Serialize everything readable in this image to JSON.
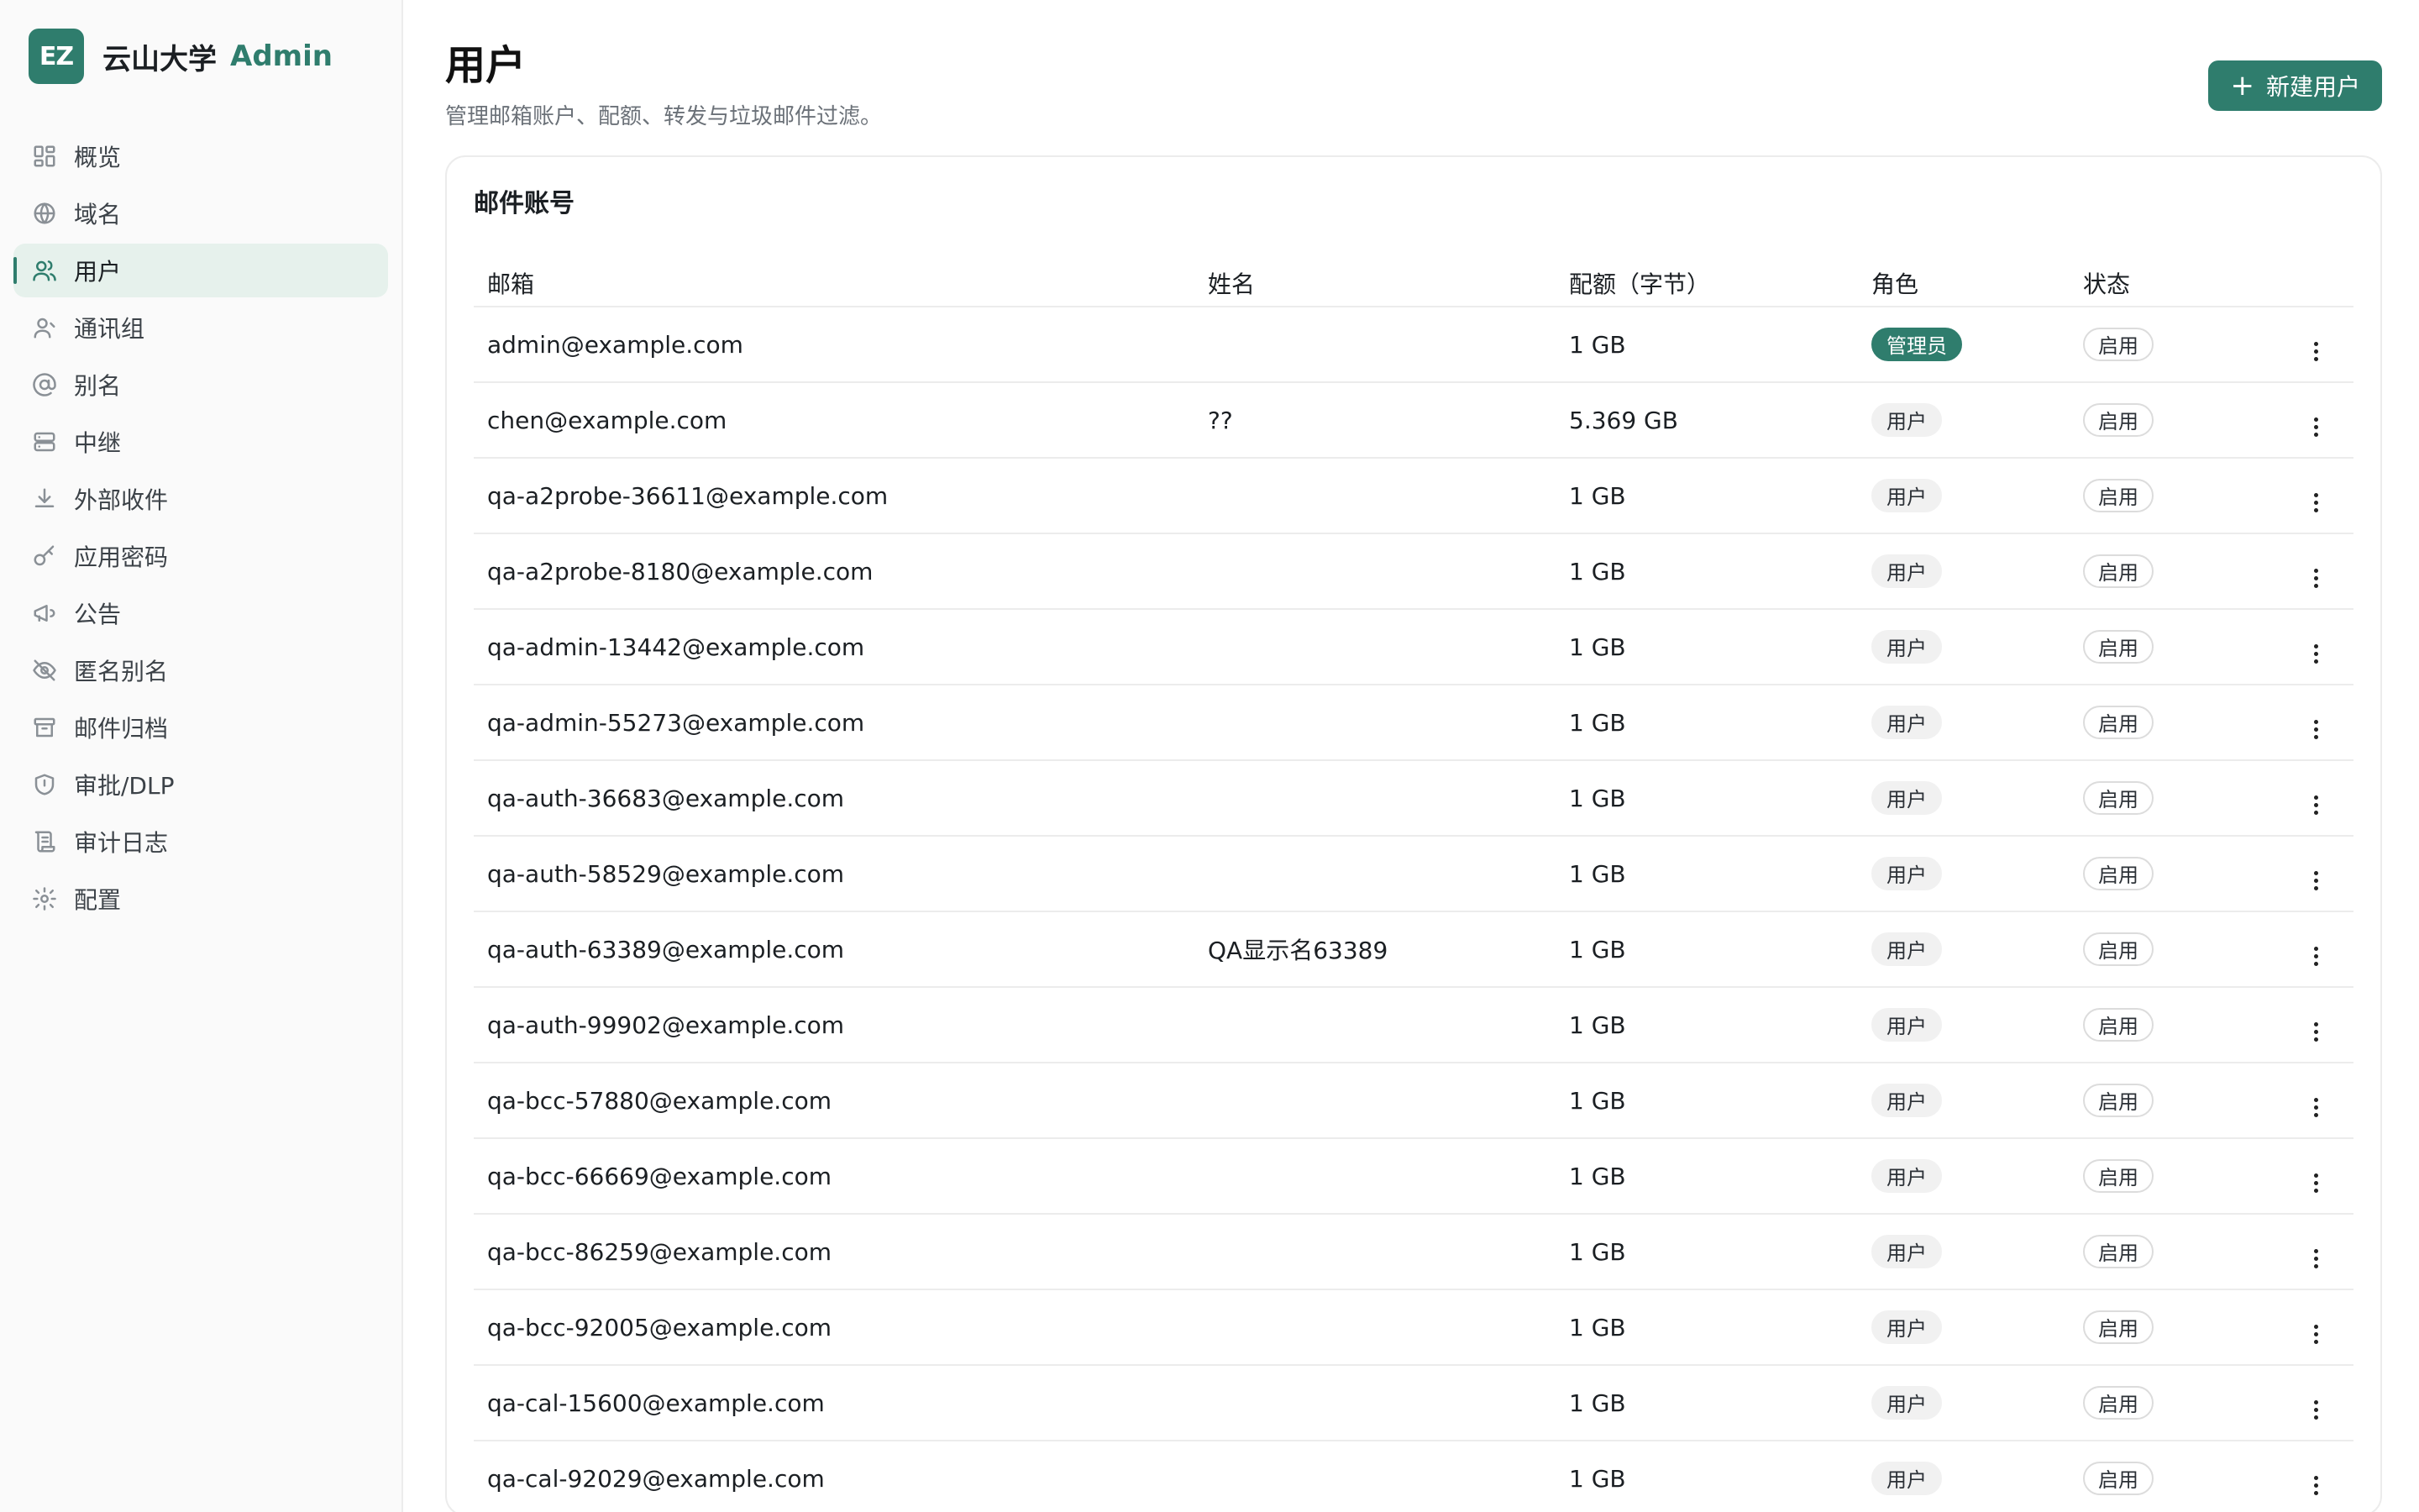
{
  "brand": {
    "logo": "EZ",
    "name": "云山大学",
    "admin": "Admin",
    "color": "#2f7d6d"
  },
  "sidebar": {
    "items": [
      {
        "label": "概览",
        "icon": "dashboard-icon"
      },
      {
        "label": "域名",
        "icon": "globe-icon"
      },
      {
        "label": "用户",
        "icon": "users-icon",
        "active": true
      },
      {
        "label": "通讯组",
        "icon": "user-group-icon"
      },
      {
        "label": "别名",
        "icon": "at-icon"
      },
      {
        "label": "中继",
        "icon": "server-icon"
      },
      {
        "label": "外部收件",
        "icon": "download-icon"
      },
      {
        "label": "应用密码",
        "icon": "key-icon"
      },
      {
        "label": "公告",
        "icon": "megaphone-icon"
      },
      {
        "label": "匿名别名",
        "icon": "eye-off-icon"
      },
      {
        "label": "邮件归档",
        "icon": "archive-icon"
      },
      {
        "label": "审批/DLP",
        "icon": "shield-icon"
      },
      {
        "label": "审计日志",
        "icon": "scroll-icon"
      },
      {
        "label": "配置",
        "icon": "gear-icon"
      }
    ]
  },
  "header": {
    "title": "用户",
    "subtitle": "管理邮箱账户、配额、转发与垃圾邮件过滤。",
    "new_button": "新建用户"
  },
  "card": {
    "title": "邮件账号",
    "columns": [
      "邮箱",
      "姓名",
      "配额（字节）",
      "角色",
      "状态"
    ],
    "rows": [
      {
        "email": "admin@example.com",
        "name": "",
        "quota": "1 GB",
        "role": "管理员",
        "role_admin": true,
        "status": "启用"
      },
      {
        "email": "chen@example.com",
        "name": "??",
        "quota": "5.369 GB",
        "role": "用户",
        "status": "启用"
      },
      {
        "email": "qa-a2probe-36611@example.com",
        "name": "",
        "quota": "1 GB",
        "role": "用户",
        "status": "启用"
      },
      {
        "email": "qa-a2probe-8180@example.com",
        "name": "",
        "quota": "1 GB",
        "role": "用户",
        "status": "启用"
      },
      {
        "email": "qa-admin-13442@example.com",
        "name": "",
        "quota": "1 GB",
        "role": "用户",
        "status": "启用"
      },
      {
        "email": "qa-admin-55273@example.com",
        "name": "",
        "quota": "1 GB",
        "role": "用户",
        "status": "启用"
      },
      {
        "email": "qa-auth-36683@example.com",
        "name": "",
        "quota": "1 GB",
        "role": "用户",
        "status": "启用"
      },
      {
        "email": "qa-auth-58529@example.com",
        "name": "",
        "quota": "1 GB",
        "role": "用户",
        "status": "启用"
      },
      {
        "email": "qa-auth-63389@example.com",
        "name": "QA显示名63389",
        "quota": "1 GB",
        "role": "用户",
        "status": "启用"
      },
      {
        "email": "qa-auth-99902@example.com",
        "name": "",
        "quota": "1 GB",
        "role": "用户",
        "status": "启用"
      },
      {
        "email": "qa-bcc-57880@example.com",
        "name": "",
        "quota": "1 GB",
        "role": "用户",
        "status": "启用"
      },
      {
        "email": "qa-bcc-66669@example.com",
        "name": "",
        "quota": "1 GB",
        "role": "用户",
        "status": "启用"
      },
      {
        "email": "qa-bcc-86259@example.com",
        "name": "",
        "quota": "1 GB",
        "role": "用户",
        "status": "启用"
      },
      {
        "email": "qa-bcc-92005@example.com",
        "name": "",
        "quota": "1 GB",
        "role": "用户",
        "status": "启用"
      },
      {
        "email": "qa-cal-15600@example.com",
        "name": "",
        "quota": "1 GB",
        "role": "用户",
        "status": "启用"
      },
      {
        "email": "qa-cal-92029@example.com",
        "name": "",
        "quota": "1 GB",
        "role": "用户",
        "status": "启用"
      }
    ]
  }
}
